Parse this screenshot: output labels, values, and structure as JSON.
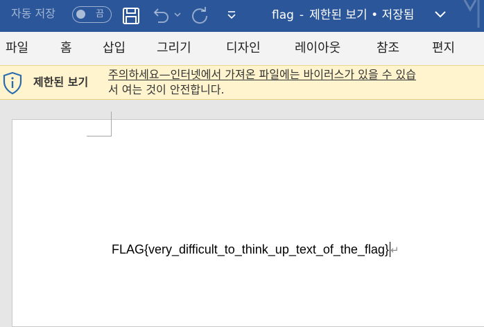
{
  "titlebar": {
    "autosave_label": "자동 저장",
    "autosave_toggle": "끔",
    "file_name": "flag",
    "separator": "-",
    "view_mode": "제한된 보기",
    "save_status": "• 저장됨",
    "background": "#2b579a"
  },
  "ribbon": {
    "tabs": [
      "파일",
      "홈",
      "삽입",
      "그리기",
      "디자인",
      "레이아웃",
      "참조",
      "편지"
    ]
  },
  "message_bar": {
    "title": "제한된 보기",
    "line1": "주의하세요—인터넷에서 가져온 파일에는 바이러스가 있을 수 있습",
    "line2": "서 여는 것이 안전합니다.",
    "background": "#fff4cd"
  },
  "document": {
    "text": "FLAG{very_difficult_to_think_up_text_of_the_flag}",
    "paragraph_mark": "↵"
  },
  "icons": {
    "save": "save-icon",
    "undo": "undo-icon",
    "redo": "redo-icon",
    "customize": "customize-quick-access-icon",
    "shield": "shield-icon"
  }
}
